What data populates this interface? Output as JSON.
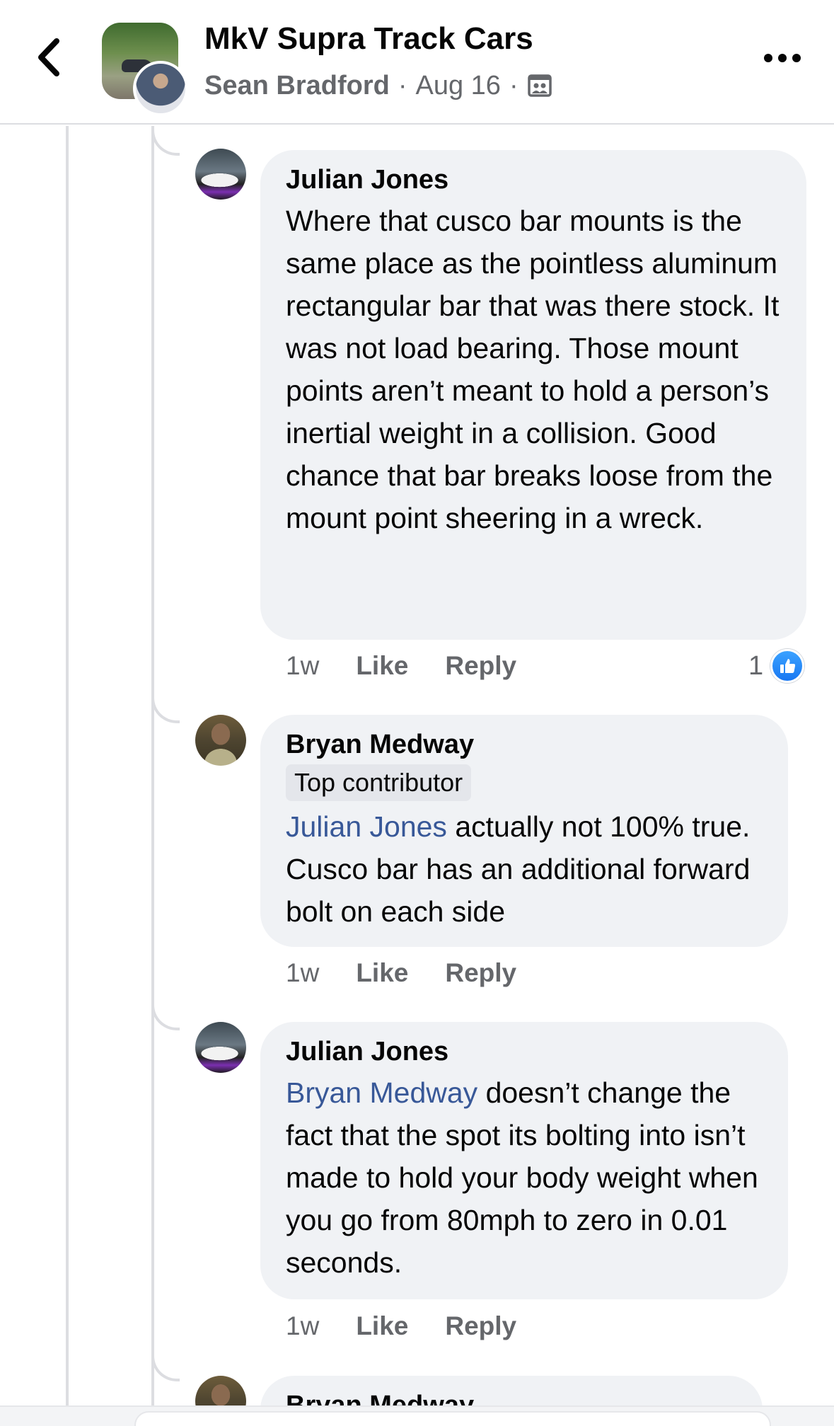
{
  "header": {
    "group_name": "MkV Supra Track Cars",
    "author": "Sean Bradford",
    "date": "Aug 16",
    "separator": "·",
    "privacy_icon": "group-privacy-icon",
    "back_icon": "chevron-left-icon",
    "more_icon": "more-dots-icon"
  },
  "comments": [
    {
      "author": "Julian Jones",
      "badge": "",
      "text": "Where that cusco bar mounts is the same place as the pointless aluminum rectangular bar that was there stock. It was not load bearing. Those mount points aren’t meant to hold a person’s inertial weight in a collision. Good chance that bar breaks loose from the mount point sheering in a wreck.",
      "time": "1w",
      "like_label": "Like",
      "reply_label": "Reply",
      "reaction_count": "1",
      "reaction_icon": "like-reaction-icon"
    },
    {
      "author": "Bryan Medway",
      "badge": "Top contributor",
      "mention": "Julian Jones",
      "text": " actually not 100% true. Cusco bar has an additional forward bolt on each side",
      "time": "1w",
      "like_label": "Like",
      "reply_label": "Reply"
    },
    {
      "author": "Julian Jones",
      "badge": "",
      "mention": "Bryan Medway",
      "text": " doesn’t change the fact that the spot its bolting into isn’t made to hold your body weight when you go from 80mph to zero in 0.01 seconds.",
      "time": "1w",
      "like_label": "Like",
      "reply_label": "Reply"
    },
    {
      "author": "Bryan Medway"
    }
  ],
  "colors": {
    "bubble": "#f0f2f5",
    "mention": "#385898",
    "secondary_text": "#65676b",
    "like_blue": "#1877f2"
  }
}
